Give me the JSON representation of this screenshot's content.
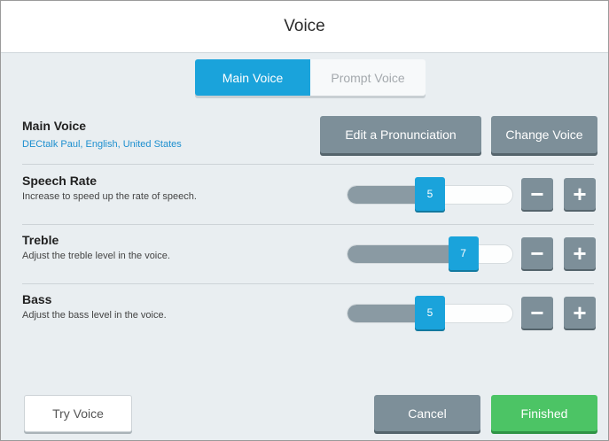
{
  "window": {
    "title": "Voice"
  },
  "tabs": [
    {
      "label": "Main Voice",
      "active": true
    },
    {
      "label": "Prompt Voice",
      "active": false
    }
  ],
  "main_voice": {
    "title": "Main Voice",
    "voice_name": "DECtalk Paul, English, United States",
    "edit_button": "Edit a Pronunciation",
    "change_button": "Change Voice"
  },
  "speech_rate": {
    "title": "Speech Rate",
    "description": "Increase to speed up the rate of speech.",
    "value": "5",
    "level": 0.5
  },
  "treble": {
    "title": "Treble",
    "description": "Adjust the treble level in the voice.",
    "value": "7",
    "level": 0.7
  },
  "bass": {
    "title": "Bass",
    "description": "Adjust the bass level in the voice.",
    "value": "5",
    "level": 0.5
  },
  "stepper": {
    "minus": "−",
    "plus": "+"
  },
  "footer": {
    "try_voice": "Try Voice",
    "cancel": "Cancel",
    "finished": "Finished"
  },
  "colors": {
    "accent": "#1aa3db",
    "button_gray": "#7d8f99",
    "finished_green": "#4cc465",
    "background": "#e9eef1"
  }
}
